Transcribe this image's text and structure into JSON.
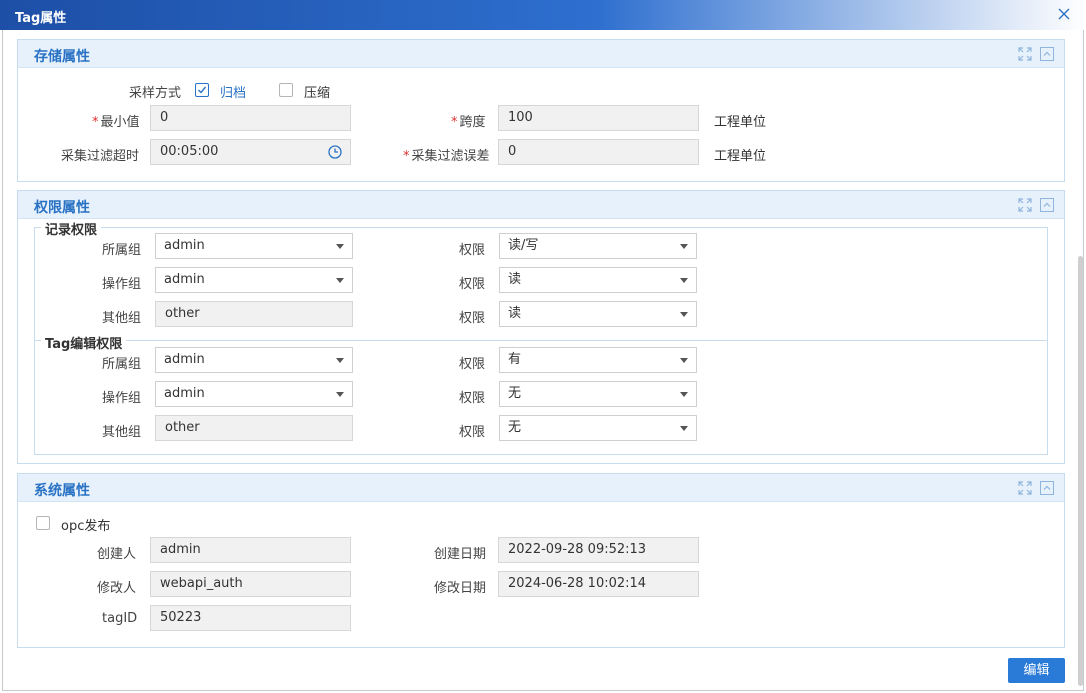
{
  "window": {
    "title": "Tag属性"
  },
  "storage": {
    "title": "存储属性",
    "sample_mode_label": "采样方式",
    "archive_label": "归档",
    "archive_checked": true,
    "compress_label": "压缩",
    "compress_checked": false,
    "min_label": "最小值",
    "min_value": "0",
    "span_label": "跨度",
    "span_value": "100",
    "span_unit": "工程单位",
    "timeout_label": "采集过滤超时",
    "timeout_value": "00:05:00",
    "deviation_label": "采集过滤误差",
    "deviation_value": "0",
    "deviation_unit": "工程单位"
  },
  "permission": {
    "title": "权限属性",
    "record": {
      "legend": "记录权限",
      "rows": [
        {
          "group_label": "所属组",
          "group_value": "admin",
          "perm_label": "权限",
          "perm_value": "读/写"
        },
        {
          "group_label": "操作组",
          "group_value": "admin",
          "perm_label": "权限",
          "perm_value": "读"
        },
        {
          "group_label": "其他组",
          "group_value": "other",
          "perm_label": "权限",
          "perm_value": "读"
        }
      ]
    },
    "edit": {
      "legend": "Tag编辑权限",
      "rows": [
        {
          "group_label": "所属组",
          "group_value": "admin",
          "perm_label": "权限",
          "perm_value": "有"
        },
        {
          "group_label": "操作组",
          "group_value": "admin",
          "perm_label": "权限",
          "perm_value": "无"
        },
        {
          "group_label": "其他组",
          "group_value": "other",
          "perm_label": "权限",
          "perm_value": "无"
        }
      ]
    }
  },
  "system": {
    "title": "系统属性",
    "opc_label": "opc发布",
    "opc_checked": false,
    "creator_label": "创建人",
    "creator_value": "admin",
    "created_label": "创建日期",
    "created_value": "2022-09-28 09:52:13",
    "modifier_label": "修改人",
    "modifier_value": "webapi_auth",
    "modified_label": "修改日期",
    "modified_value": "2024-06-28 10:02:14",
    "tagid_label": "tagID",
    "tagid_value": "50223"
  },
  "footer": {
    "edit_button": "编辑"
  },
  "colors": {
    "accent": "#2a72c4",
    "title_bar": "#1d4fa6",
    "panel_head": "#e6f1fb",
    "button": "#2a7ad8",
    "required": "#e0302e"
  },
  "icons": [
    "close-icon",
    "expand-icon",
    "collapse-icon",
    "checkbox-checked-icon",
    "checkbox-icon",
    "clock-icon",
    "dropdown-arrow-icon"
  ]
}
